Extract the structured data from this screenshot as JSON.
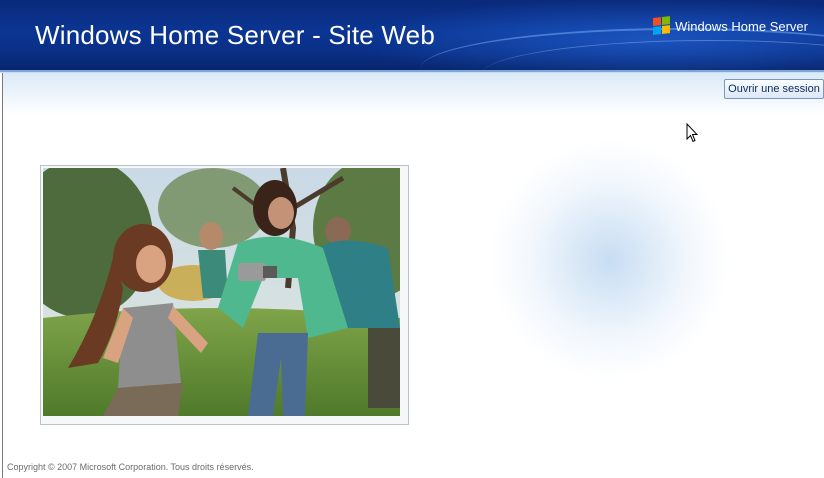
{
  "header": {
    "title": "Windows Home Server - Site Web",
    "brand_name": "Windows Home Server",
    "brand_icon": "windows-flag-icon"
  },
  "toolbar": {
    "login_label": "Ouvrir une session"
  },
  "main": {
    "photo_icon": "family-photo"
  },
  "footer": {
    "copyright": "Copyright © 2007 Microsoft Corporation. Tous droits réservés."
  },
  "colors": {
    "banner_dark": "#0a2a7a",
    "banner_mid": "#0b3593",
    "band_light": "#dbeaf8",
    "button_border": "#7c98b8"
  }
}
